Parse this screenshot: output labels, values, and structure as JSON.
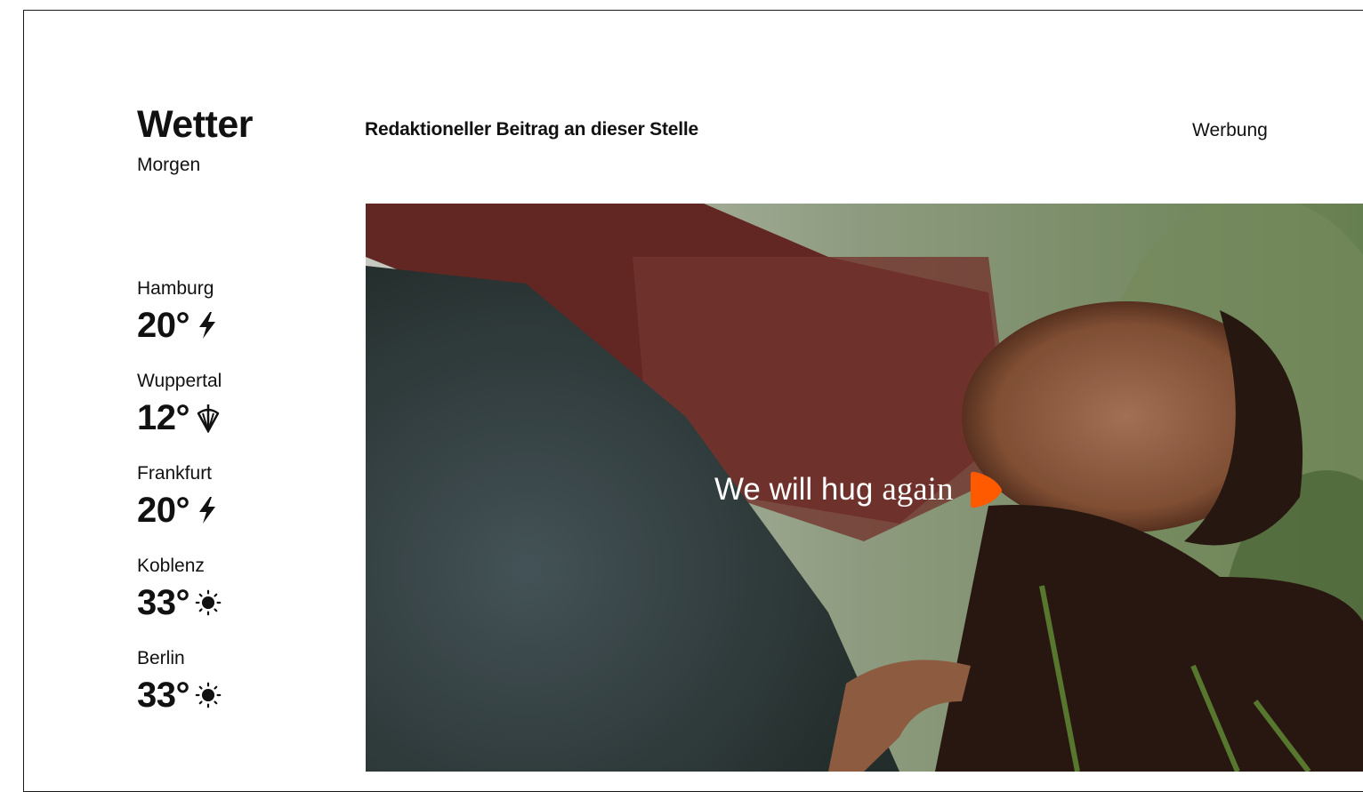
{
  "weather": {
    "title": "Wetter",
    "subtitle": "Morgen",
    "cities": [
      {
        "name": "Hamburg",
        "temp": "20°",
        "icon": "thunder-icon"
      },
      {
        "name": "Wuppertal",
        "temp": "12°",
        "icon": "umbrella-icon"
      },
      {
        "name": "Frankfurt",
        "temp": "20°",
        "icon": "thunder-icon"
      },
      {
        "name": "Koblenz",
        "temp": "33°",
        "icon": "sun-icon"
      },
      {
        "name": "Berlin",
        "temp": "33°",
        "icon": "sun-icon"
      }
    ]
  },
  "editorial": {
    "label": "Redaktioneller Beitrag an dieser Stelle"
  },
  "ad": {
    "label": "Werbung",
    "slogan_part1": "We will hug",
    "slogan_part2": "again",
    "brand_color": "#ff5a00"
  }
}
